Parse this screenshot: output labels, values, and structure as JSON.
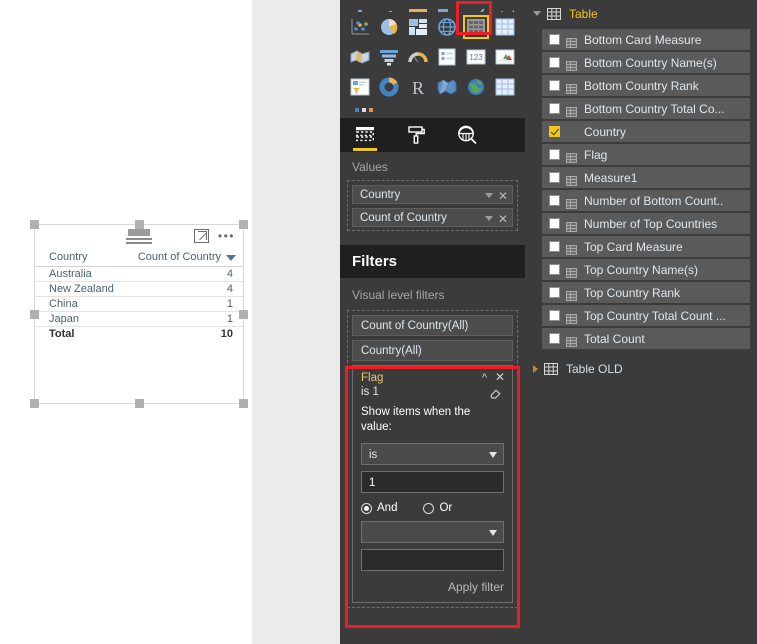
{
  "report_visual": {
    "toolbar": {
      "focus_icon": "focus-mode-icon",
      "more_icon": "more-options-icon",
      "grip_icon": "drag-grip-icon"
    },
    "table": {
      "columns": [
        "Country",
        "Count of Country"
      ],
      "rows": [
        {
          "country": "Australia",
          "count": "4"
        },
        {
          "country": "New Zealand",
          "count": "4"
        },
        {
          "country": "China",
          "count": "1"
        },
        {
          "country": "Japan",
          "count": "1"
        }
      ],
      "total_label": "Total",
      "total_value": "10"
    }
  },
  "visualizations": {
    "gallery": {
      "selected_index": 9,
      "icons": [
        "stacked-column-chart-icon",
        "clustered-column-chart-icon",
        "hundred-percent-stacked-column-icon",
        "stacked-bar-chart-icon",
        "line-chart-icon",
        "area-chart-icon",
        "scatter-chart-icon",
        "pie-chart-icon",
        "treemap-icon",
        "map-icon",
        "table-icon",
        "matrix-icon",
        "filled-map-icon",
        "funnel-chart-icon",
        "gauge-icon",
        "multi-row-card-icon",
        "card-icon",
        "kpi-icon",
        "slicer-icon",
        "donut-chart-icon",
        "r-script-visual-icon",
        "shape-map-icon",
        "arcgis-map-icon",
        "matrix-alt-icon"
      ],
      "more_visuals_label": "get-more-visuals-icon"
    },
    "tabs": [
      {
        "name": "fields-tab",
        "icon": "fields-pane-icon",
        "active": true
      },
      {
        "name": "format-tab",
        "icon": "paint-roller-icon",
        "active": false
      },
      {
        "name": "analytics-tab",
        "icon": "magnifier-icon",
        "active": false
      }
    ],
    "values": {
      "section_label": "Values",
      "chips": [
        {
          "label": "Country"
        },
        {
          "label": "Count of Country"
        }
      ]
    }
  },
  "filters": {
    "header": "Filters",
    "visual_level_label": "Visual level filters",
    "cards": [
      {
        "label": "Count of Country(All)"
      },
      {
        "label": "Country(All)"
      }
    ],
    "active_card": {
      "title": "Flag",
      "summary": "is 1",
      "prompt": "Show items when the value:",
      "condition": "is",
      "value": "1",
      "and_label": "And",
      "or_label": "Or",
      "and_selected": true,
      "second_condition": "",
      "second_value": "",
      "apply_label": "Apply filter",
      "clear_icon": "eraser-icon",
      "collapse_icon": "chevron-up-icon",
      "close_icon": "close-icon"
    }
  },
  "fields": {
    "tables": [
      {
        "name": "Table",
        "expanded": true,
        "fields": [
          {
            "label": "Bottom Card Measure",
            "checked": false,
            "measure": true
          },
          {
            "label": "Bottom Country Name(s)",
            "checked": false,
            "measure": true
          },
          {
            "label": "Bottom Country Rank",
            "checked": false,
            "measure": true
          },
          {
            "label": "Bottom Country Total Co...",
            "checked": false,
            "measure": true
          },
          {
            "label": "Country",
            "checked": true,
            "measure": false
          },
          {
            "label": "Flag",
            "checked": false,
            "measure": true
          },
          {
            "label": "Measure1",
            "checked": false,
            "measure": true
          },
          {
            "label": "Number of Bottom Count..",
            "checked": false,
            "measure": true
          },
          {
            "label": "Number of Top Countries",
            "checked": false,
            "measure": true
          },
          {
            "label": "Top Card Measure",
            "checked": false,
            "measure": true
          },
          {
            "label": "Top Country Name(s)",
            "checked": false,
            "measure": true
          },
          {
            "label": "Top Country Rank",
            "checked": false,
            "measure": true
          },
          {
            "label": "Top Country Total Count ...",
            "checked": false,
            "measure": true
          },
          {
            "label": "Total Count",
            "checked": false,
            "measure": true
          }
        ]
      },
      {
        "name": "Table OLD",
        "expanded": false,
        "fields": []
      }
    ]
  },
  "colors": {
    "accent": "#f2c811",
    "annotation": "#ee1c25",
    "pane_bg": "#3b3b3b",
    "header_bg": "#1f1f1f"
  }
}
